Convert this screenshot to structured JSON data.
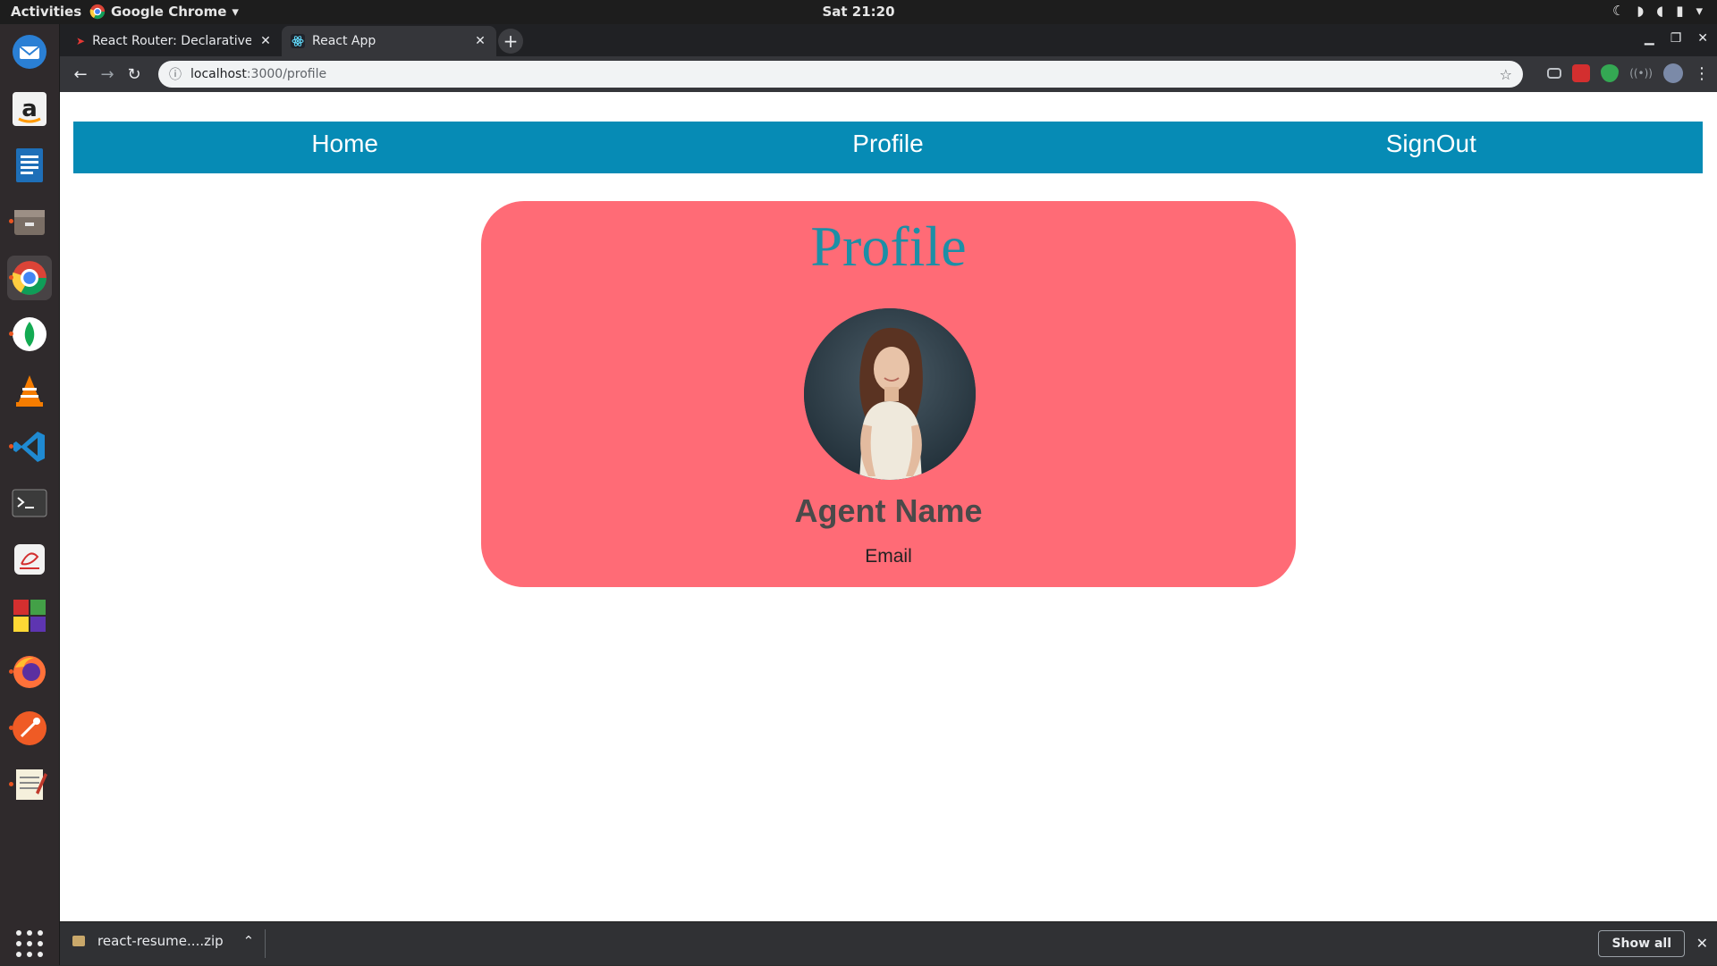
{
  "topbar": {
    "activities": "Activities",
    "app_name": "Google Chrome",
    "clock": "Sat 21:20"
  },
  "browser": {
    "tabs": [
      {
        "title": "React Router: Declarative",
        "active": false
      },
      {
        "title": "React App",
        "active": true
      }
    ],
    "url_host": "localhost",
    "url_path": ":3000/profile"
  },
  "page": {
    "nav": {
      "home": "Home",
      "profile": "Profile",
      "signout": "SignOut"
    },
    "card": {
      "title": "Profile",
      "name": "Agent Name",
      "email": "Email"
    }
  },
  "downloads": {
    "file": "react-resume....zip",
    "show_all": "Show all"
  },
  "colors": {
    "nav_bg": "#068bb5",
    "card_bg": "#ff6b76",
    "card_title": "#1c8fa6"
  },
  "dock": [
    "thunderbird-icon",
    "amazon-icon",
    "writer-icon",
    "files-icon",
    "chrome-icon",
    "mongodb-icon",
    "vlc-icon",
    "vscode-icon",
    "terminal-icon",
    "app-icon",
    "blocks-icon",
    "firefox-icon",
    "postman-icon",
    "text-editor-icon",
    "show-apps-icon"
  ]
}
